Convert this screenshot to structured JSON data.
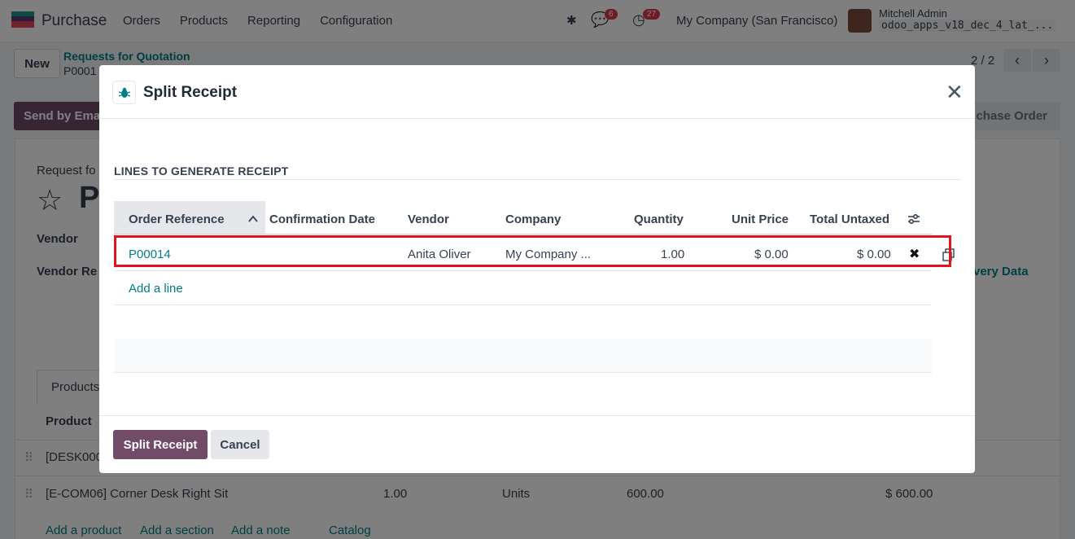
{
  "navbar": {
    "app_name": "Purchase",
    "menu": [
      "Orders",
      "Products",
      "Reporting",
      "Configuration"
    ],
    "messages_count": "6",
    "activities_count": "27",
    "company": "My Company (San Francisco)",
    "user_name": "Mitchell Admin",
    "db_name": "odoo_apps_v18_dec_4_lat_..."
  },
  "control": {
    "new_label": "New",
    "breadcrumb_parent": "Requests for Quotation",
    "breadcrumb_current": "P0001",
    "pager": "2 / 2"
  },
  "status": {
    "send_email": "Send by Emai",
    "po_stage": "chase Order"
  },
  "sheet": {
    "request_label": "Request fo",
    "title_initial": "P",
    "vendor_label": "Vendor",
    "vendor_ref_label": "Vendor Re",
    "delivery_label": "very Data",
    "tab_products": "Products",
    "product_header": "Product",
    "row1_product": "[DESK000",
    "row2_product": "[E-COM06] Corner Desk Right Sit",
    "row2_qty": "1.00",
    "row2_uom": "Units",
    "row2_price": "600.00",
    "row2_total": "$ 600.00",
    "add_product": "Add a product",
    "add_section": "Add a section",
    "add_note": "Add a note",
    "catalog": "Catalog"
  },
  "modal": {
    "title": "Split Receipt",
    "section_title": "LINES TO GENERATE RECEIPT",
    "columns": [
      "Order Reference",
      "Confirmation Date",
      "Vendor",
      "Company",
      "Quantity",
      "Unit Price",
      "Total Untaxed"
    ],
    "row": {
      "order_reference": "P00014",
      "confirmation_date": "",
      "vendor": "Anita Oliver",
      "company": "My Company ...",
      "quantity": "1.00",
      "unit_price": "$ 0.00",
      "total_untaxed": "$ 0.00"
    },
    "add_line": "Add a line",
    "split_button": "Split Receipt",
    "cancel_button": "Cancel"
  },
  "colors": {
    "brand": "#714b67",
    "link": "#017e84",
    "highlight": "#e5141c"
  }
}
